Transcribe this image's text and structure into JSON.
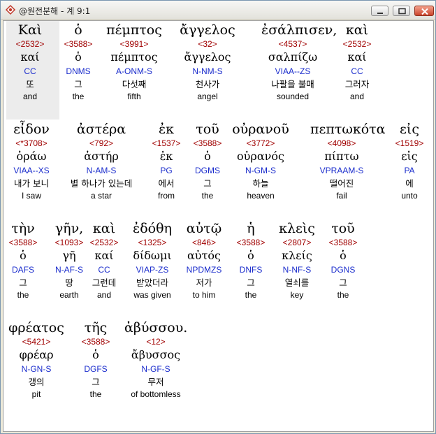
{
  "window": {
    "title": "@원전분해 - 계 9:1",
    "buttons": {
      "minimize": "minimize",
      "maximize": "maximize",
      "close": "close"
    }
  },
  "words": [
    {
      "greek": "Καὶ",
      "strong": "<2532>",
      "lemma": "καί",
      "parse": "CC",
      "korean": "또",
      "english": "and"
    },
    {
      "greek": "ὁ",
      "strong": "<3588>",
      "lemma": "ὁ",
      "parse": "DNMS",
      "korean": "그",
      "english": "the"
    },
    {
      "greek": "πέμπτος",
      "strong": "<3991>",
      "lemma": "πέμπτος",
      "parse": "A-ONM-S",
      "korean": "다섯째",
      "english": "fifth"
    },
    {
      "greek": "ἄγγελος",
      "strong": "<32>",
      "lemma": "ἄγγελος",
      "parse": "N-NM-S",
      "korean": "천사가",
      "english": "angel"
    },
    {
      "greek": "ἐσάλπισεν,",
      "strong": "<4537>",
      "lemma": "σαλπίζω",
      "parse": "VIAA--ZS",
      "korean": "나팔을 불매",
      "english": "sounded"
    },
    {
      "greek": "καὶ",
      "strong": "<2532>",
      "lemma": "καί",
      "parse": "CC",
      "korean": "그러자",
      "english": "and"
    },
    {
      "greek": "εἶδον",
      "strong": "<*3708>",
      "lemma": "ὁράω",
      "parse": "VIAA--XS",
      "korean": "내가 보니",
      "english": "I saw"
    },
    {
      "greek": "ἀστέρα",
      "strong": "<792>",
      "lemma": "ἀστήρ",
      "parse": "N-AM-S",
      "korean": "별 하나가 있는데",
      "english": "a star"
    },
    {
      "greek": "ἐκ",
      "strong": "<1537>",
      "lemma": "ἐκ",
      "parse": "PG",
      "korean": "에서",
      "english": "from"
    },
    {
      "greek": "τοῦ",
      "strong": "<3588>",
      "lemma": "ὁ",
      "parse": "DGMS",
      "korean": "그",
      "english": "the"
    },
    {
      "greek": "οὐρανοῦ",
      "strong": "<3772>",
      "lemma": "οὐρανός",
      "parse": "N-GM-S",
      "korean": "하늘",
      "english": "heaven"
    },
    {
      "greek": "πεπτωκότα",
      "strong": "<4098>",
      "lemma": "πίπτω",
      "parse": "VPRAAM-S",
      "korean": "떨어진",
      "english": "fail"
    },
    {
      "greek": "εἰς",
      "strong": "<1519>",
      "lemma": "εἰς",
      "parse": "PA",
      "korean": "에",
      "english": "unto"
    },
    {
      "greek": "τὴν",
      "strong": "<3588>",
      "lemma": "ὁ",
      "parse": "DAFS",
      "korean": "그",
      "english": "the"
    },
    {
      "greek": "γῆν,",
      "strong": "<1093>",
      "lemma": "γῆ",
      "parse": "N-AF-S",
      "korean": "땅",
      "english": "earth"
    },
    {
      "greek": "καὶ",
      "strong": "<2532>",
      "lemma": "καί",
      "parse": "CC",
      "korean": "그런데",
      "english": "and"
    },
    {
      "greek": "ἐδόθη",
      "strong": "<1325>",
      "lemma": "δίδωμι",
      "parse": "VIAP-ZS",
      "korean": "받았더라",
      "english": "was given"
    },
    {
      "greek": "αὐτῷ",
      "strong": "<846>",
      "lemma": "αὐτός",
      "parse": "NPDMZS",
      "korean": "저가",
      "english": "to him"
    },
    {
      "greek": "ἡ",
      "strong": "<3588>",
      "lemma": "ὁ",
      "parse": "DNFS",
      "korean": "그",
      "english": "the"
    },
    {
      "greek": "κλεὶς",
      "strong": "<2807>",
      "lemma": "κλείς",
      "parse": "N-NF-S",
      "korean": "열쇠를",
      "english": "key"
    },
    {
      "greek": "τοῦ",
      "strong": "<3588>",
      "lemma": "ὁ",
      "parse": "DGNS",
      "korean": "그",
      "english": "the"
    },
    {
      "greek": "φρέατος",
      "strong": "<5421>",
      "lemma": "φρέαρ",
      "parse": "N-GN-S",
      "korean": "갱의",
      "english": "pit"
    },
    {
      "greek": "τῆς",
      "strong": "<3588>",
      "lemma": "ὁ",
      "parse": "DGFS",
      "korean": "그",
      "english": "the"
    },
    {
      "greek": "ἀβύσσου.",
      "strong": "<12>",
      "lemma": "ἄβυσσος",
      "parse": "N-GF-S",
      "korean": "무저",
      "english": "of bottomless"
    }
  ]
}
